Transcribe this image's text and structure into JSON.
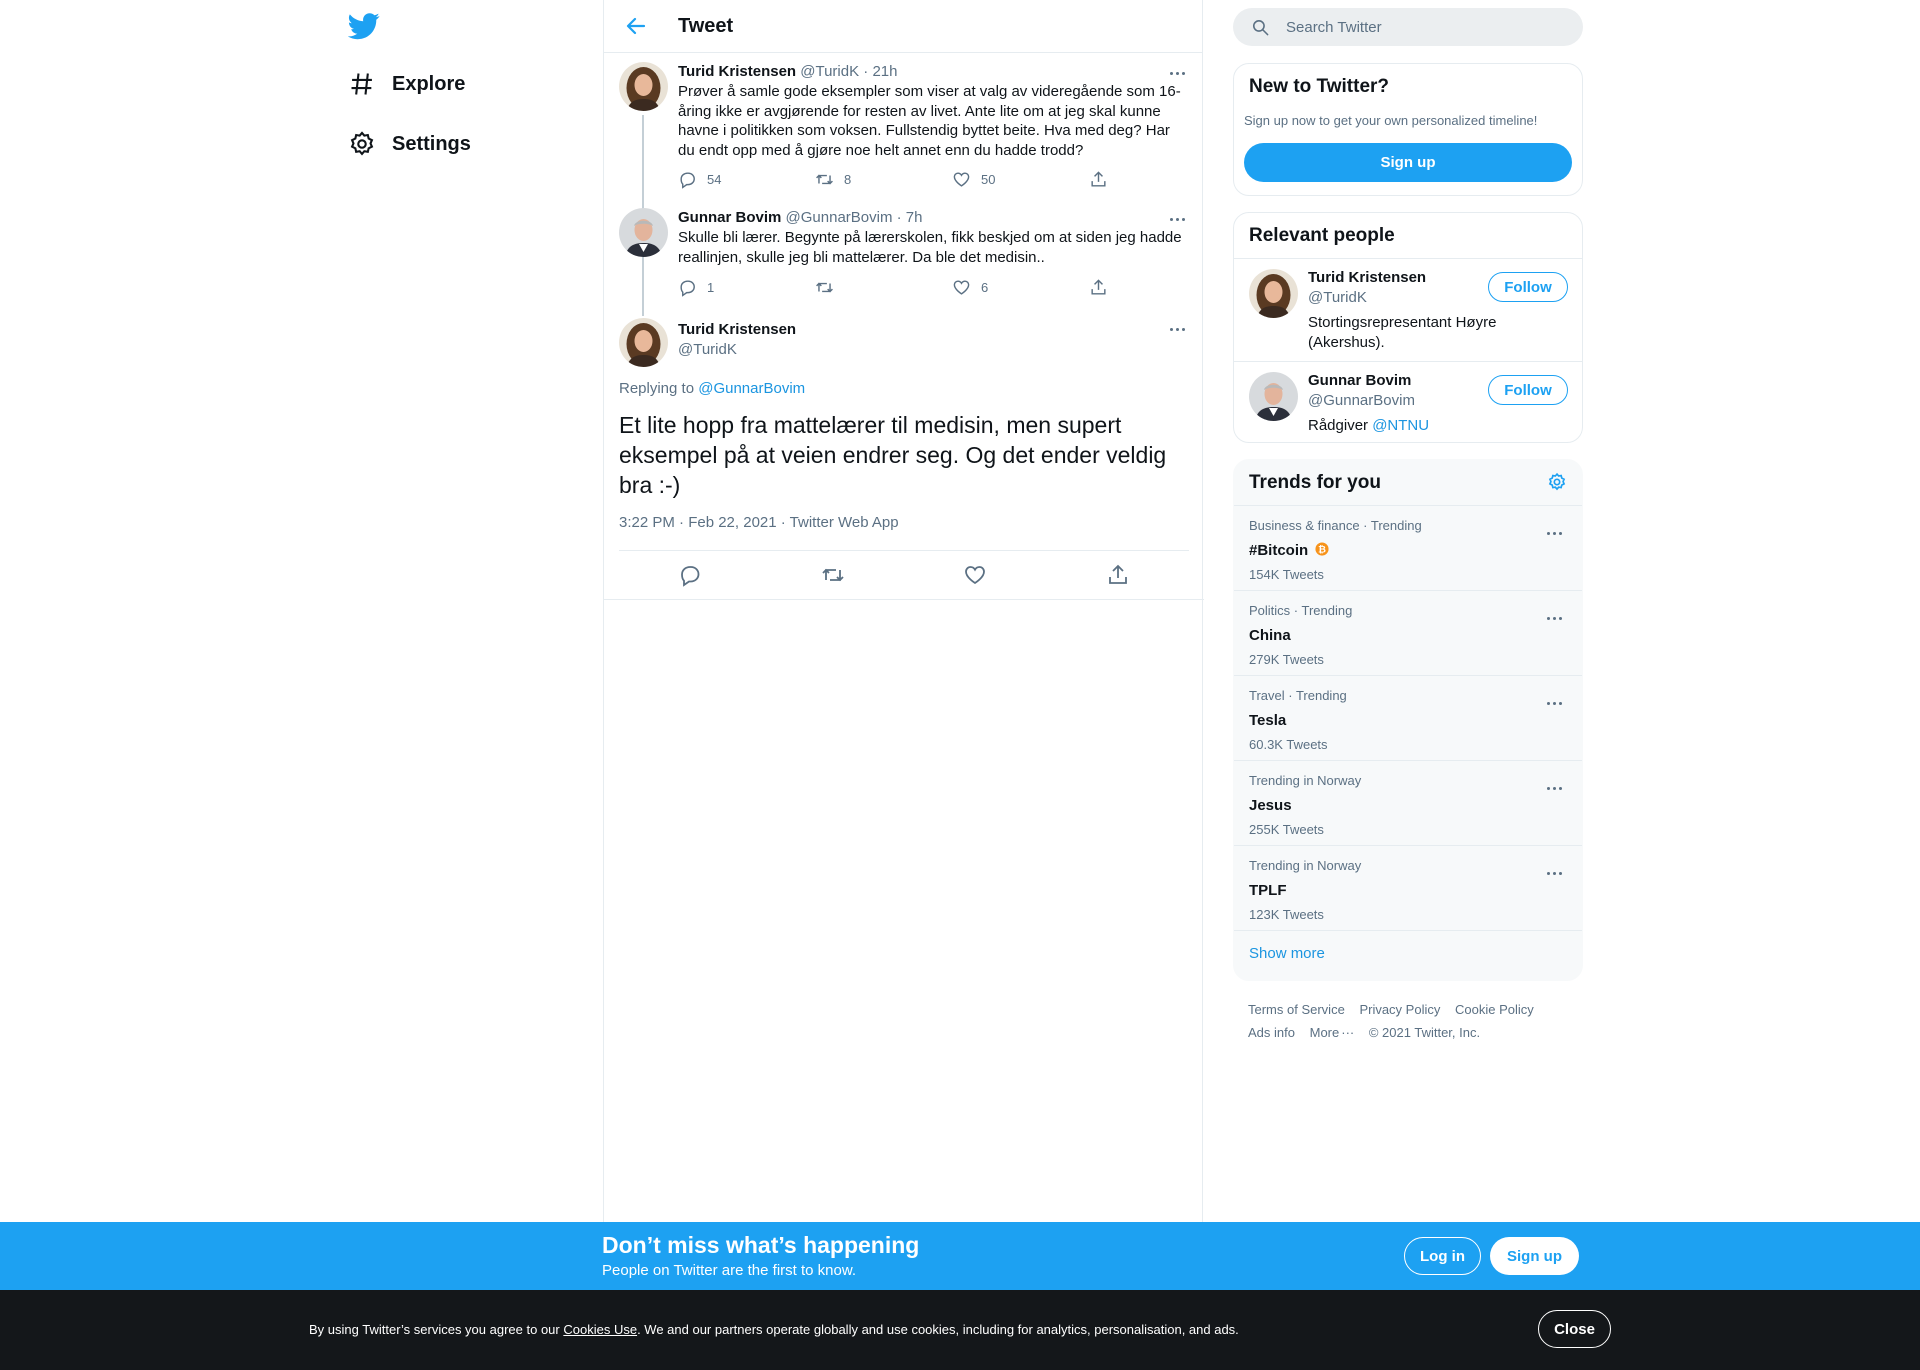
{
  "nav": {
    "explore_label": "Explore",
    "settings_label": "Settings"
  },
  "header": {
    "title": "Tweet"
  },
  "thread": [
    {
      "name": "Turid Kristensen",
      "handle": "@TuridK",
      "time": "· 21h",
      "text": "Prøver å samle gode eksempler som viser at valg av videregående som 16-åring ikke er avgjørende for resten av livet. Ante lite om at jeg skal kunne havne i politikken som voksen. Fullstendig byttet beite. Hva med deg? Har du endt opp med å gjøre noe helt annet enn du hadde trodd?",
      "replies": "54",
      "retweets": "8",
      "likes": "50"
    },
    {
      "name": "Gunnar Bovim",
      "handle": "@GunnarBovim",
      "time": "· 7h",
      "text": "Skulle bli lærer. Begynte på lærerskolen, fikk beskjed om at siden jeg hadde reallinjen, skulle jeg bli mattelærer. Da ble det medisin..",
      "replies": "1",
      "retweets": "",
      "likes": "6"
    }
  ],
  "main_tweet": {
    "name": "Turid Kristensen",
    "handle": "@TuridK",
    "replying_prefix": "Replying to ",
    "replying_to": "@GunnarBovim",
    "text": "Et lite hopp fra mattelærer til medisin, men supert eksempel på at veien endrer seg. Og det ender veldig bra :-)",
    "meta": "3:22 PM · Feb 22, 2021 · Twitter Web App"
  },
  "search": {
    "placeholder": "Search Twitter"
  },
  "new_to_twitter": {
    "title": "New to Twitter?",
    "subtitle": "Sign up now to get your own personalized timeline!",
    "button": "Sign up"
  },
  "relevant_people": {
    "title": "Relevant people",
    "people": [
      {
        "name": "Turid Kristensen",
        "handle": "@TuridK",
        "bio": "Stortingsrepresentant Høyre (Akershus).",
        "follow": "Follow"
      },
      {
        "name": "Gunnar Bovim",
        "handle": "@GunnarBovim",
        "bio_prefix": "Rådgiver ",
        "bio_link": "@NTNU",
        "follow": "Follow"
      }
    ]
  },
  "trends": {
    "title": "Trends for you",
    "items": [
      {
        "meta": "Business & finance · Trending",
        "name": "#Bitcoin",
        "count": "154K Tweets",
        "has_emoji": true
      },
      {
        "meta": "Politics · Trending",
        "name": "China",
        "count": "279K Tweets"
      },
      {
        "meta": "Travel · Trending",
        "name": "Tesla",
        "count": "60.3K Tweets"
      },
      {
        "meta": "Trending in Norway",
        "name": "Jesus",
        "count": "255K Tweets"
      },
      {
        "meta": "Trending in Norway",
        "name": "TPLF",
        "count": "123K Tweets"
      }
    ],
    "show_more": "Show more"
  },
  "footer": {
    "links": [
      "Terms of Service",
      "Privacy Policy",
      "Cookie Policy",
      "Ads info",
      "More"
    ],
    "copyright": "© 2021 Twitter, Inc."
  },
  "banner": {
    "title": "Don’t miss what’s happening",
    "subtitle": "People on Twitter are the first to know.",
    "login": "Log in",
    "signup": "Sign up"
  },
  "cookie": {
    "text_before": "By using Twitter’s services you agree to our ",
    "link": "Cookies Use",
    "text_after": ". We and our partners operate globally and use cookies, including for analytics, personalisation, and ads.",
    "close": "Close"
  },
  "colors": {
    "accent": "#1da1f2",
    "link": "#1b95e0",
    "secondary_text": "#5b7083",
    "cookie_bg": "#14171a"
  }
}
